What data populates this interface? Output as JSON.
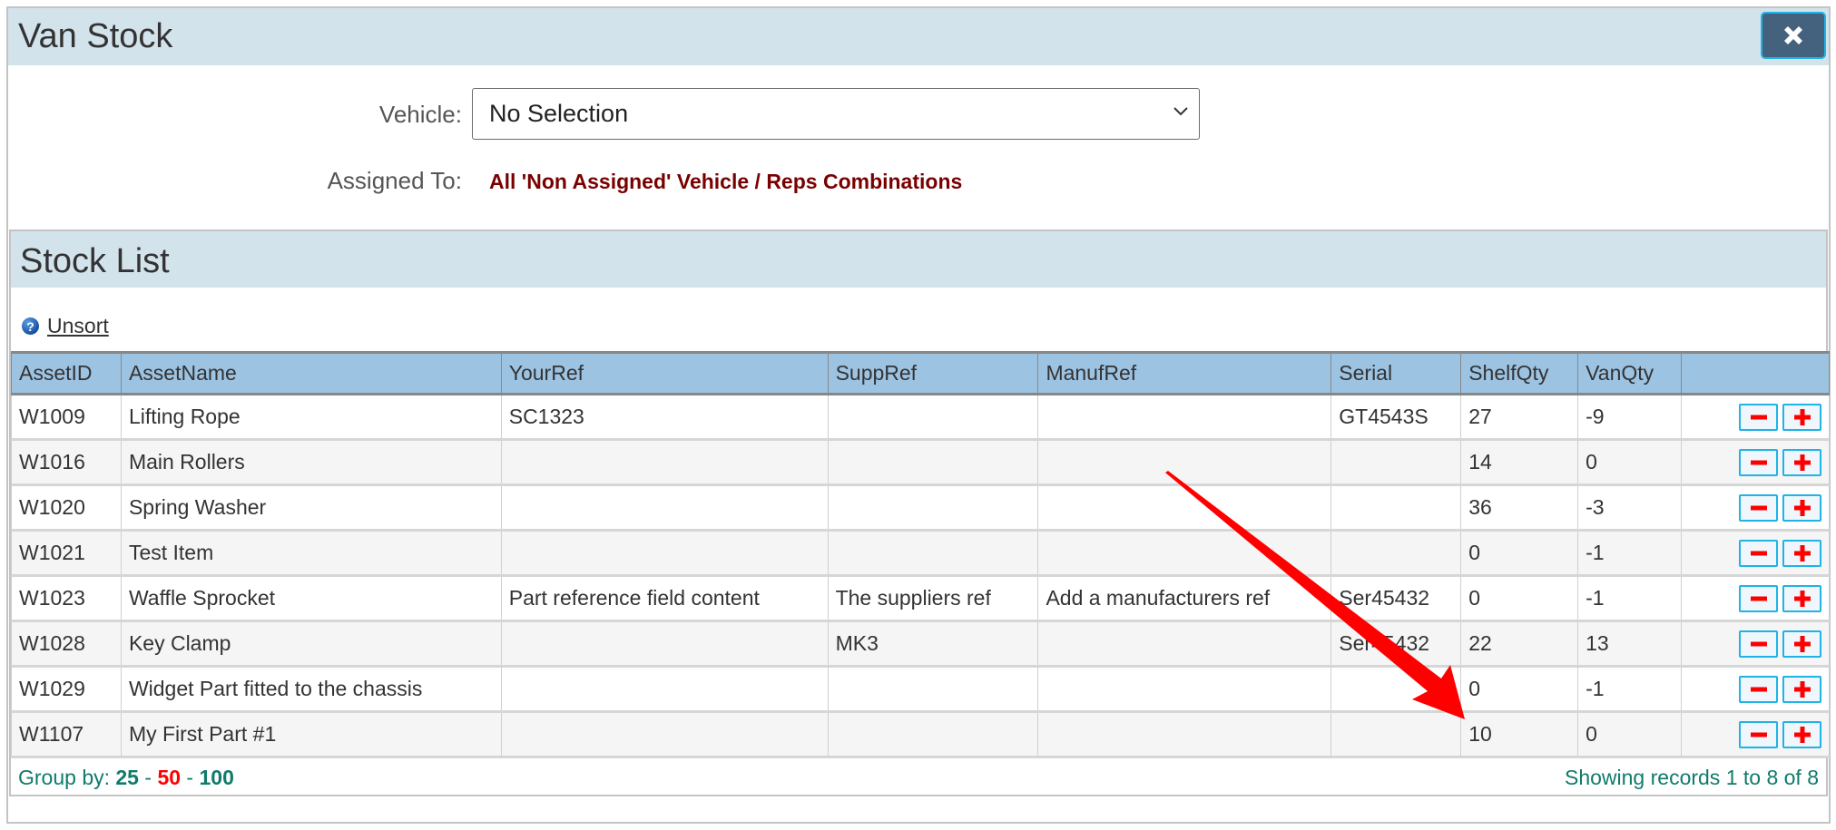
{
  "window": {
    "title": "Van Stock",
    "close_icon": "close-x-icon"
  },
  "form": {
    "vehicle_label": "Vehicle:",
    "vehicle_value": "No Selection",
    "assigned_label": "Assigned To:",
    "assigned_value": "All 'Non Assigned' Vehicle / Reps Combinations"
  },
  "stock_list": {
    "title": "Stock List",
    "help_icon": "question-circle-icon",
    "unsort_label": "Unsort",
    "columns": [
      "AssetID",
      "AssetName",
      "YourRef",
      "SuppRef",
      "ManufRef",
      "Serial",
      "ShelfQty",
      "VanQty",
      ""
    ],
    "rows": [
      {
        "asset_id": "W1009",
        "asset_name": "Lifting Rope",
        "your_ref": "SC1323",
        "supp_ref": "",
        "manuf_ref": "",
        "serial": "GT4543S",
        "shelf_qty": "27",
        "van_qty": "-9"
      },
      {
        "asset_id": "W1016",
        "asset_name": "Main Rollers",
        "your_ref": "",
        "supp_ref": "",
        "manuf_ref": "",
        "serial": "",
        "shelf_qty": "14",
        "van_qty": "0"
      },
      {
        "asset_id": "W1020",
        "asset_name": "Spring Washer",
        "your_ref": "",
        "supp_ref": "",
        "manuf_ref": "",
        "serial": "",
        "shelf_qty": "36",
        "van_qty": "-3"
      },
      {
        "asset_id": "W1021",
        "asset_name": "Test Item",
        "your_ref": "",
        "supp_ref": "",
        "manuf_ref": "",
        "serial": "",
        "shelf_qty": "0",
        "van_qty": "-1"
      },
      {
        "asset_id": "W1023",
        "asset_name": "Waffle Sprocket",
        "your_ref": "Part reference field content",
        "supp_ref": "The suppliers ref",
        "manuf_ref": "Add a manufacturers ref",
        "serial": "Ser45432",
        "shelf_qty": "0",
        "van_qty": "-1"
      },
      {
        "asset_id": "W1028",
        "asset_name": "Key Clamp",
        "your_ref": "",
        "supp_ref": "MK3",
        "manuf_ref": "",
        "serial": "Ser45432",
        "shelf_qty": "22",
        "van_qty": "13"
      },
      {
        "asset_id": "W1029",
        "asset_name": "Widget Part fitted to the chassis",
        "your_ref": "",
        "supp_ref": "",
        "manuf_ref": "",
        "serial": "",
        "shelf_qty": "0",
        "van_qty": "-1"
      },
      {
        "asset_id": "W1107",
        "asset_name": "My First Part #1",
        "your_ref": "",
        "supp_ref": "",
        "manuf_ref": "",
        "serial": "",
        "shelf_qty": "10",
        "van_qty": "0"
      }
    ],
    "row_actions": {
      "decrement_icon": "minus-icon",
      "increment_icon": "plus-icon"
    }
  },
  "footer": {
    "group_by_label": "Group by:",
    "group_options": [
      "25",
      "50",
      "100"
    ],
    "separator": "-",
    "selected_group": "50",
    "records_text": "Showing records 1 to 8 of 8"
  },
  "colors": {
    "title_bar": "#d3e3ec",
    "header_row": "#9dc3e2",
    "assigned_text": "#7a0000",
    "footer_text": "#0f7b6c",
    "selected_group": "#ff0000",
    "close_button": "#44627e",
    "annotation_arrow": "#ff0000"
  },
  "annotation": {
    "type": "arrow",
    "points_to": "W1107 ShelfQty 10"
  }
}
